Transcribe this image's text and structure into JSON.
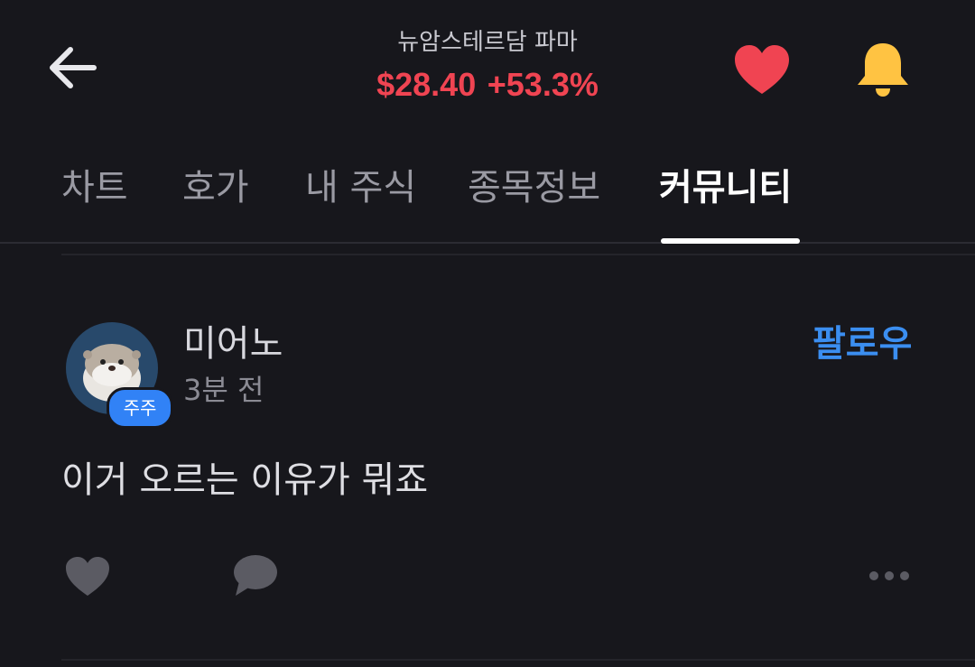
{
  "header": {
    "back_icon": "arrow-left-icon",
    "stock_name": "뉴암스테르담 파마",
    "price": "$28.40",
    "change": "+53.3%",
    "favorite_icon": "heart-icon",
    "alert_icon": "bell-icon"
  },
  "colors": {
    "background": "#17171c",
    "price_up": "#f04452",
    "accent_blue": "#3182f6",
    "heart": "#f04452",
    "bell": "#ffc342"
  },
  "tabs": [
    {
      "label": "차트",
      "active": false
    },
    {
      "label": "호가",
      "active": false
    },
    {
      "label": "내 주식",
      "active": false
    },
    {
      "label": "종목정보",
      "active": false
    },
    {
      "label": "커뮤니티",
      "active": true
    }
  ],
  "post": {
    "author": "미어노",
    "badge": "주주",
    "time": "3분 전",
    "follow_label": "팔로우",
    "body": "이거 오르는 이유가 뭐죠",
    "like_icon": "heart-outline-icon",
    "comment_icon": "comment-icon",
    "more_icon": "more-horizontal-icon"
  }
}
